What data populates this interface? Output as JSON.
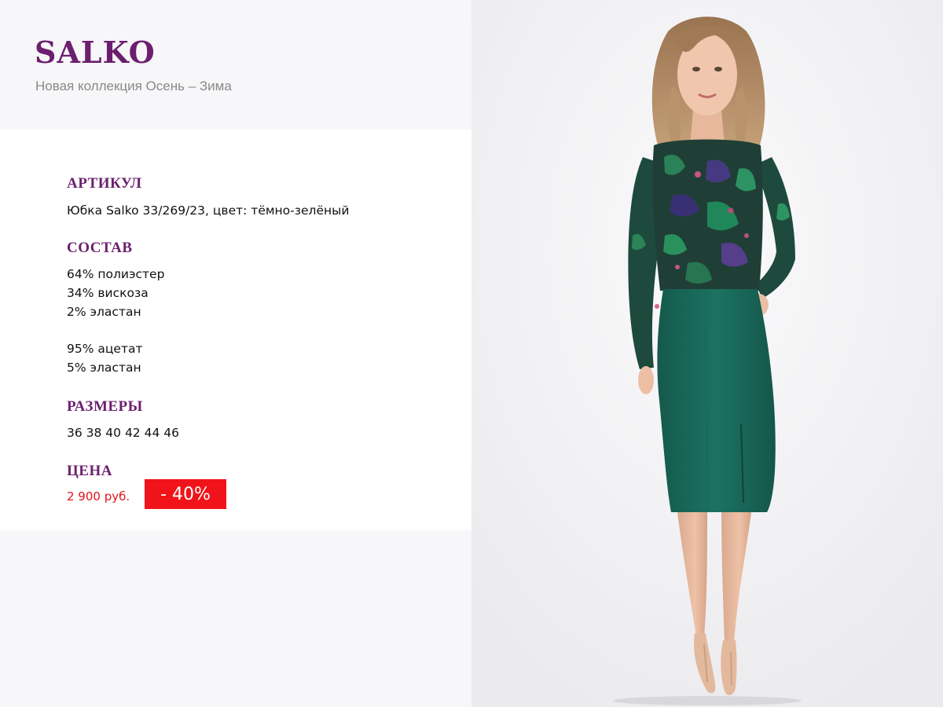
{
  "header": {
    "brand": "SALKO",
    "subtitle": "Новая коллекция Осень – Зима"
  },
  "article": {
    "heading": "АРТИКУЛ",
    "value": "Юбка Salko 33/269/23, цвет: тёмно-зелёный"
  },
  "composition": {
    "heading": "СОСТАВ",
    "group1": [
      "64% полиэстер",
      "34% вискоза",
      "2% эластан"
    ],
    "group2": [
      "95% ацетат",
      "5% эластан"
    ]
  },
  "sizes": {
    "heading": "РАЗМЕРЫ",
    "value": "36 38 40 42 44 46"
  },
  "price": {
    "heading": "ЦЕНА",
    "value": "2 900 руб.",
    "discount": "- 40%"
  },
  "colors": {
    "brand": "#6b1f6e",
    "price": "#e3141b",
    "discount_bg": "#f0141a",
    "skirt": "#1a6b5b"
  },
  "photo": {
    "icon": "model-photo-icon"
  }
}
